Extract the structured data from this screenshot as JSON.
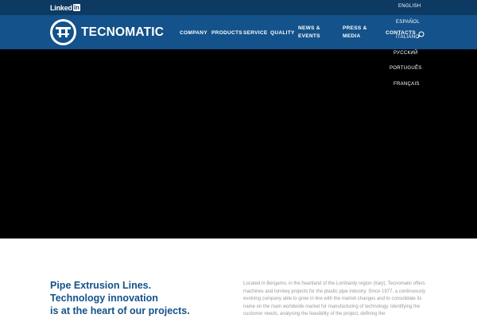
{
  "topbar": {
    "linkedin_text": "Linked",
    "linkedin_box": "in"
  },
  "brand": {
    "name": "TECNOMATIC",
    "color_primary": "#13528a",
    "color_topbar": "#0d3a62"
  },
  "nav": {
    "items": [
      {
        "label": "COMPANY"
      },
      {
        "label": "PRODUCTS"
      },
      {
        "label": "SERVICE"
      },
      {
        "label": "QUALITY"
      },
      {
        "label_line1": "NEWS &",
        "label_line2": "EVENTS"
      },
      {
        "label_line1": "PRESS &",
        "label_line2": "MEDIA"
      },
      {
        "label": "CONTACTS"
      }
    ],
    "search_icon": "search-icon"
  },
  "languages": [
    {
      "label": "ENGLISH",
      "flag": "uk-flag"
    },
    {
      "label": "ESPAÑOL",
      "flag": "spain-flag"
    },
    {
      "label": "ITALIANO",
      "flag": "italy-flag"
    },
    {
      "label": "РУССКИЙ",
      "flag": "russia-flag"
    },
    {
      "label": "PORTUGUÊS",
      "flag": "portugal-flag"
    },
    {
      "label": "FRANÇAIS",
      "flag": "france-flag"
    }
  ],
  "intro": {
    "title_line1": "Pipe Extrusion Lines.",
    "title_line2": "Technology innovation",
    "title_line3": "is at the heart of our projects.",
    "body": "Located in Bergamo, in the heartland of the Lombardy region (Italy), Tecnomatic offers machines and turnkey projects for the plastic pipe industry. Since 1977, a continuously evolving company able to grow in line with the market changes and to consolidate its name on the main worldwide market for manufacturing of technology. Identifying the customer needs, analysing the feasibility of the project, defining the"
  }
}
